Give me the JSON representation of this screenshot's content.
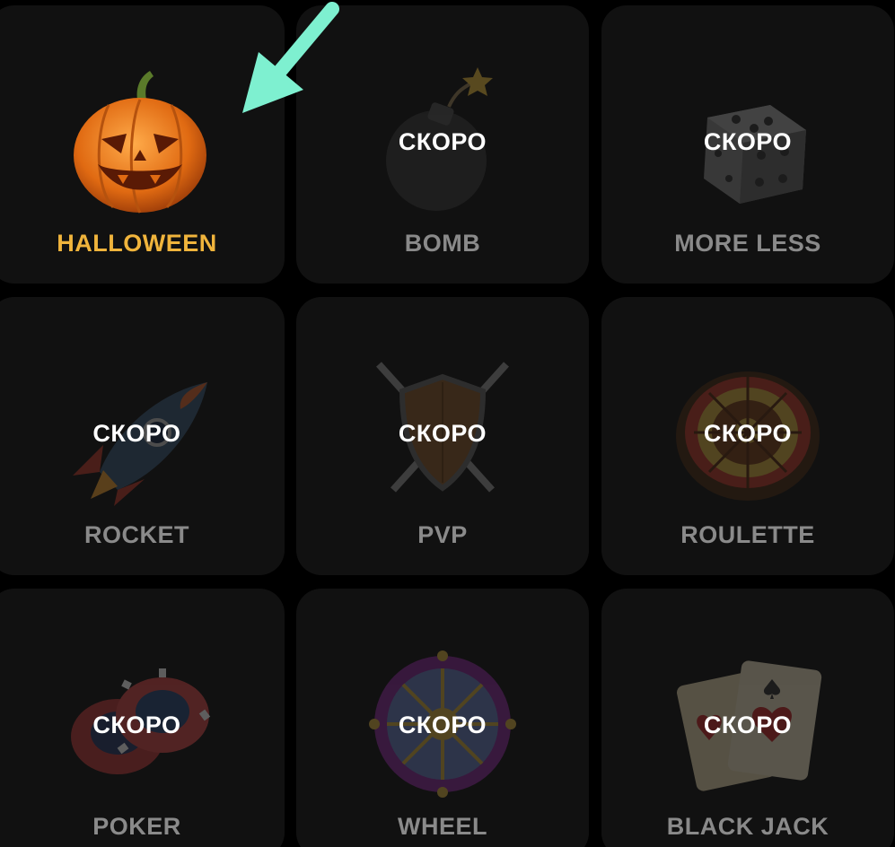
{
  "colors": {
    "background": "#000000",
    "card": "#111111",
    "title_active": "#f0b43c",
    "title_inactive": "#8a8a8a",
    "overlay_text": "#ffffff",
    "arrow": "#7ef0d0"
  },
  "games": [
    {
      "title": "HALLOWEEN",
      "icon": "pumpkin-icon",
      "status": ""
    },
    {
      "title": "BOMB",
      "icon": "bomb-icon",
      "status": "СКОРО"
    },
    {
      "title": "MORE LESS",
      "icon": "dice-icon",
      "status": "СКОРО"
    },
    {
      "title": "ROCKET",
      "icon": "rocket-icon",
      "status": "СКОРО"
    },
    {
      "title": "PVP",
      "icon": "shield-swords-icon",
      "status": "СКОРО"
    },
    {
      "title": "ROULETTE",
      "icon": "roulette-wheel-icon",
      "status": "СКОРО"
    },
    {
      "title": "POKER",
      "icon": "poker-chips-icon",
      "status": "СКОРО"
    },
    {
      "title": "WHEEL",
      "icon": "fortune-wheel-icon",
      "status": "СКОРО"
    },
    {
      "title": "BLACK JACK",
      "icon": "playing-cards-icon",
      "status": "СКОРО"
    }
  ],
  "annotation": {
    "icon": "arrow-icon"
  }
}
